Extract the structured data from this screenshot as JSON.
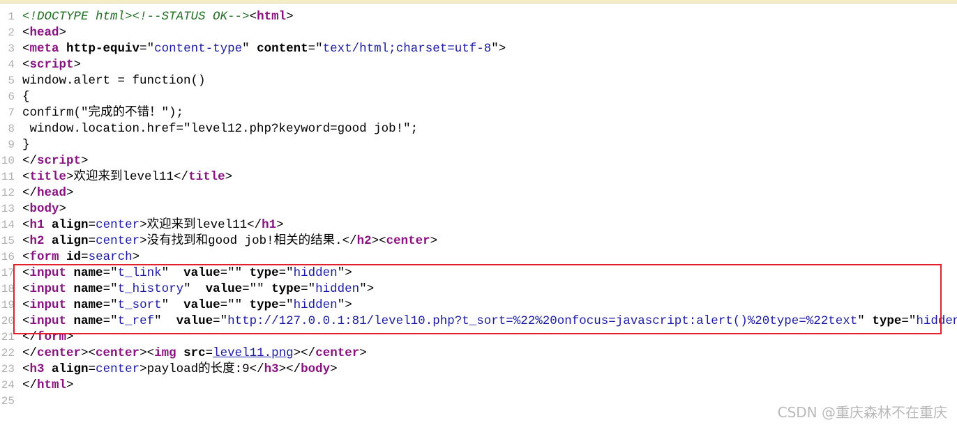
{
  "source_lines": [
    {
      "n": "1",
      "segs": [
        {
          "t": "<!DOCTYPE html>",
          "c": "dt"
        },
        {
          "t": "<!--STATUS OK-->",
          "c": "cm"
        },
        {
          "t": "<",
          "c": "b"
        },
        {
          "t": "html",
          "c": "tg"
        },
        {
          "t": ">",
          "c": "b"
        }
      ]
    },
    {
      "n": "2",
      "segs": [
        {
          "t": "<",
          "c": "b"
        },
        {
          "t": "head",
          "c": "tg"
        },
        {
          "t": ">",
          "c": "b"
        }
      ]
    },
    {
      "n": "3",
      "segs": [
        {
          "t": "<",
          "c": "b"
        },
        {
          "t": "meta",
          "c": "tg"
        },
        {
          "t": " ",
          "c": "b"
        },
        {
          "t": "http-equiv",
          "c": "at"
        },
        {
          "t": "=\"",
          "c": "b"
        },
        {
          "t": "content-type",
          "c": "av"
        },
        {
          "t": "\" ",
          "c": "b"
        },
        {
          "t": "content",
          "c": "at"
        },
        {
          "t": "=\"",
          "c": "b"
        },
        {
          "t": "text/html;charset=utf-8",
          "c": "av"
        },
        {
          "t": "\">",
          "c": "b"
        }
      ]
    },
    {
      "n": "4",
      "segs": [
        {
          "t": "<",
          "c": "b"
        },
        {
          "t": "script",
          "c": "tg"
        },
        {
          "t": ">",
          "c": "b"
        }
      ]
    },
    {
      "n": "5",
      "segs": [
        {
          "t": "window.alert = function()",
          "c": "b"
        }
      ]
    },
    {
      "n": "6",
      "segs": [
        {
          "t": "{",
          "c": "b"
        }
      ]
    },
    {
      "n": "7",
      "segs": [
        {
          "t": "confirm(\"完成的不错！\");",
          "c": "b"
        }
      ]
    },
    {
      "n": "8",
      "segs": [
        {
          "t": " window.location.href=\"level12.php?keyword=good job!\";",
          "c": "b"
        }
      ]
    },
    {
      "n": "9",
      "segs": [
        {
          "t": "}",
          "c": "b"
        }
      ]
    },
    {
      "n": "10",
      "segs": [
        {
          "t": "</",
          "c": "b"
        },
        {
          "t": "script",
          "c": "tg"
        },
        {
          "t": ">",
          "c": "b"
        }
      ]
    },
    {
      "n": "11",
      "segs": [
        {
          "t": "<",
          "c": "b"
        },
        {
          "t": "title",
          "c": "tg"
        },
        {
          "t": ">欢迎来到level11</",
          "c": "b"
        },
        {
          "t": "title",
          "c": "tg"
        },
        {
          "t": ">",
          "c": "b"
        }
      ]
    },
    {
      "n": "12",
      "segs": [
        {
          "t": "</",
          "c": "b"
        },
        {
          "t": "head",
          "c": "tg"
        },
        {
          "t": ">",
          "c": "b"
        }
      ]
    },
    {
      "n": "13",
      "segs": [
        {
          "t": "<",
          "c": "b"
        },
        {
          "t": "body",
          "c": "tg"
        },
        {
          "t": ">",
          "c": "b"
        }
      ]
    },
    {
      "n": "14",
      "segs": [
        {
          "t": "<",
          "c": "b"
        },
        {
          "t": "h1",
          "c": "tg"
        },
        {
          "t": " ",
          "c": "b"
        },
        {
          "t": "align",
          "c": "at"
        },
        {
          "t": "=",
          "c": "b"
        },
        {
          "t": "center",
          "c": "av"
        },
        {
          "t": ">欢迎来到level11</",
          "c": "b"
        },
        {
          "t": "h1",
          "c": "tg"
        },
        {
          "t": ">",
          "c": "b"
        }
      ]
    },
    {
      "n": "15",
      "segs": [
        {
          "t": "<",
          "c": "b"
        },
        {
          "t": "h2",
          "c": "tg"
        },
        {
          "t": " ",
          "c": "b"
        },
        {
          "t": "align",
          "c": "at"
        },
        {
          "t": "=",
          "c": "b"
        },
        {
          "t": "center",
          "c": "av"
        },
        {
          "t": ">没有找到和good job!相关的结果.</",
          "c": "b"
        },
        {
          "t": "h2",
          "c": "tg"
        },
        {
          "t": "><",
          "c": "b"
        },
        {
          "t": "center",
          "c": "tg"
        },
        {
          "t": ">",
          "c": "b"
        }
      ]
    },
    {
      "n": "16",
      "segs": [
        {
          "t": "<",
          "c": "b"
        },
        {
          "t": "form",
          "c": "tg"
        },
        {
          "t": " ",
          "c": "b"
        },
        {
          "t": "id",
          "c": "at"
        },
        {
          "t": "=",
          "c": "b"
        },
        {
          "t": "search",
          "c": "av"
        },
        {
          "t": ">",
          "c": "b"
        }
      ]
    },
    {
      "n": "17",
      "segs": [
        {
          "t": "<",
          "c": "b"
        },
        {
          "t": "input",
          "c": "tg"
        },
        {
          "t": " ",
          "c": "b"
        },
        {
          "t": "name",
          "c": "at"
        },
        {
          "t": "=\"",
          "c": "b"
        },
        {
          "t": "t_link",
          "c": "av"
        },
        {
          "t": "\"  ",
          "c": "b"
        },
        {
          "t": "value",
          "c": "at"
        },
        {
          "t": "=\"\" ",
          "c": "b"
        },
        {
          "t": "type",
          "c": "at"
        },
        {
          "t": "=\"",
          "c": "b"
        },
        {
          "t": "hidden",
          "c": "av"
        },
        {
          "t": "\">",
          "c": "b"
        }
      ]
    },
    {
      "n": "18",
      "segs": [
        {
          "t": "<",
          "c": "b"
        },
        {
          "t": "input",
          "c": "tg"
        },
        {
          "t": " ",
          "c": "b"
        },
        {
          "t": "name",
          "c": "at"
        },
        {
          "t": "=\"",
          "c": "b"
        },
        {
          "t": "t_history",
          "c": "av"
        },
        {
          "t": "\"  ",
          "c": "b"
        },
        {
          "t": "value",
          "c": "at"
        },
        {
          "t": "=\"\" ",
          "c": "b"
        },
        {
          "t": "type",
          "c": "at"
        },
        {
          "t": "=\"",
          "c": "b"
        },
        {
          "t": "hidden",
          "c": "av"
        },
        {
          "t": "\">",
          "c": "b"
        }
      ]
    },
    {
      "n": "19",
      "segs": [
        {
          "t": "<",
          "c": "b"
        },
        {
          "t": "input",
          "c": "tg"
        },
        {
          "t": " ",
          "c": "b"
        },
        {
          "t": "name",
          "c": "at"
        },
        {
          "t": "=\"",
          "c": "b"
        },
        {
          "t": "t_sort",
          "c": "av"
        },
        {
          "t": "\"  ",
          "c": "b"
        },
        {
          "t": "value",
          "c": "at"
        },
        {
          "t": "=\"\" ",
          "c": "b"
        },
        {
          "t": "type",
          "c": "at"
        },
        {
          "t": "=\"",
          "c": "b"
        },
        {
          "t": "hidden",
          "c": "av"
        },
        {
          "t": "\">",
          "c": "b"
        }
      ]
    },
    {
      "n": "20",
      "segs": [
        {
          "t": "<",
          "c": "b"
        },
        {
          "t": "input",
          "c": "tg"
        },
        {
          "t": " ",
          "c": "b"
        },
        {
          "t": "name",
          "c": "at"
        },
        {
          "t": "=\"",
          "c": "b"
        },
        {
          "t": "t_ref",
          "c": "av"
        },
        {
          "t": "\"  ",
          "c": "b"
        },
        {
          "t": "value",
          "c": "at"
        },
        {
          "t": "=\"",
          "c": "b"
        },
        {
          "t": "http://127.0.0.1:81/level10.php?t_sort=%22%20onfocus=javascript:alert()%20type=%22text",
          "c": "av"
        },
        {
          "t": "\" ",
          "c": "b"
        },
        {
          "t": "type",
          "c": "at"
        },
        {
          "t": "=\"",
          "c": "b"
        },
        {
          "t": "hidden",
          "c": "av"
        },
        {
          "t": "\">",
          "c": "b"
        }
      ]
    },
    {
      "n": "21",
      "segs": [
        {
          "t": "</",
          "c": "b"
        },
        {
          "t": "form",
          "c": "tg"
        },
        {
          "t": ">",
          "c": "b"
        }
      ]
    },
    {
      "n": "22",
      "segs": [
        {
          "t": "</",
          "c": "b"
        },
        {
          "t": "center",
          "c": "tg"
        },
        {
          "t": "><",
          "c": "b"
        },
        {
          "t": "center",
          "c": "tg"
        },
        {
          "t": "><",
          "c": "b"
        },
        {
          "t": "img",
          "c": "tg"
        },
        {
          "t": " ",
          "c": "b"
        },
        {
          "t": "src",
          "c": "at"
        },
        {
          "t": "=",
          "c": "b"
        },
        {
          "t": "level11.png",
          "c": "lk"
        },
        {
          "t": "></",
          "c": "b"
        },
        {
          "t": "center",
          "c": "tg"
        },
        {
          "t": ">",
          "c": "b"
        }
      ]
    },
    {
      "n": "23",
      "segs": [
        {
          "t": "<",
          "c": "b"
        },
        {
          "t": "h3",
          "c": "tg"
        },
        {
          "t": " ",
          "c": "b"
        },
        {
          "t": "align",
          "c": "at"
        },
        {
          "t": "=",
          "c": "b"
        },
        {
          "t": "center",
          "c": "av"
        },
        {
          "t": ">payload的长度:9</",
          "c": "b"
        },
        {
          "t": "h3",
          "c": "tg"
        },
        {
          "t": "></",
          "c": "b"
        },
        {
          "t": "body",
          "c": "tg"
        },
        {
          "t": ">",
          "c": "b"
        }
      ]
    },
    {
      "n": "24",
      "segs": [
        {
          "t": "</",
          "c": "b"
        },
        {
          "t": "html",
          "c": "tg"
        },
        {
          "t": ">",
          "c": "b"
        }
      ]
    },
    {
      "n": "25",
      "segs": []
    }
  ],
  "watermark": "CSDN @重庆森林不在重庆",
  "colors": {
    "highlight_box": "#e0202a",
    "tag": "#881280",
    "attr_value": "#1a1aa6",
    "comment": "#236e25",
    "line_number": "#b0b0b0"
  }
}
